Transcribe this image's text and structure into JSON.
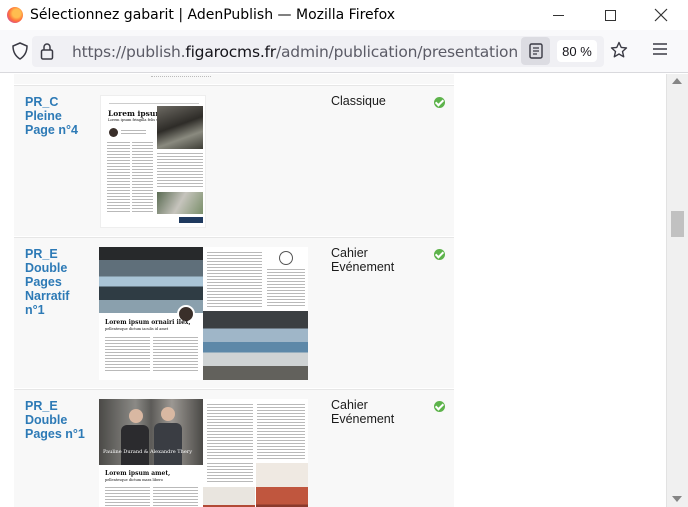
{
  "window": {
    "title": "Sélectionnez gabarit | AdenPublish — Mozilla Firefox"
  },
  "navbar": {
    "url_prefix": "https://publish.",
    "url_domain": "figarocms.fr",
    "url_suffix": "/admin/publication/presentationpublicati",
    "zoom": "80 %"
  },
  "templates": [
    {
      "code": "PR_C Pleine Page n°4",
      "family": "Classique",
      "thumb_title": "Lorem ipsum",
      "thumb_subtitle": "Lorem ipsum fringilla felis sed",
      "status": "check"
    },
    {
      "code": "PR_E Double Pages Narratif n°1",
      "family": "Cahier Evénement",
      "thumb_title": "Lorem ipsum ornairi ilex,",
      "thumb_subtitle": "pellentesque dictum iaculis id amet",
      "status": "check"
    },
    {
      "code": "PR_E Double Pages n°1",
      "family": "Cahier Evénement",
      "thumb_title": "Lorem ipsum amet,",
      "thumb_subtitle": "pellentesque dictum mara libero",
      "thumb_caption": "Pauline Durand & Alexandre Thery",
      "status": "check"
    }
  ],
  "icons": {
    "shield": "shield-icon",
    "lock": "lock-icon",
    "reader": "reader-view-icon",
    "star": "bookmark-star-icon",
    "menu": "hamburger-menu-icon",
    "check": "check-circle-icon"
  },
  "colors": {
    "code_text": "#2d7ab6",
    "check_green": "#5db34b",
    "row_background": "#f8f8f8"
  }
}
